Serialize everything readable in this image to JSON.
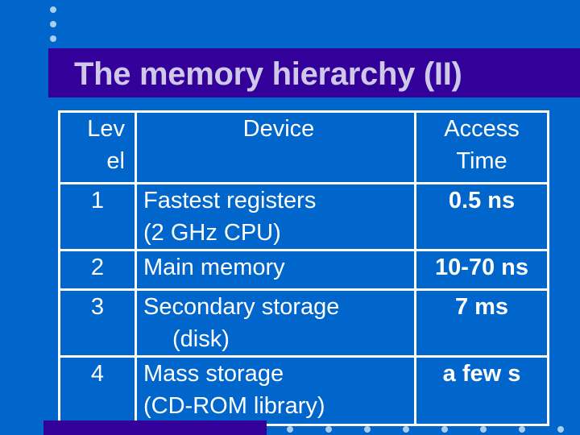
{
  "slide": {
    "title": "The memory hierarchy (II)",
    "colors": {
      "background": "#0066cc",
      "title_bar": "#330099",
      "title_text": "#cfc8e8",
      "table_text": "#ffffff",
      "dots": "#a9cdee"
    }
  },
  "table": {
    "headers": {
      "level": [
        "Lev",
        "el"
      ],
      "device": "Device",
      "access_time": [
        "Access",
        "Time"
      ]
    },
    "rows": [
      {
        "level": "1",
        "device": [
          "Fastest registers",
          "(2 GHz CPU)"
        ],
        "access_time": "0.5 ns"
      },
      {
        "level": "2",
        "device": [
          "Main memory"
        ],
        "access_time": "10-70 ns"
      },
      {
        "level": "3",
        "device": [
          "Secondary storage",
          "(disk)"
        ],
        "access_time": "7 ms"
      },
      {
        "level": "4",
        "device": [
          "Mass storage",
          "(CD-ROM library)"
        ],
        "access_time": "a few s"
      }
    ]
  }
}
